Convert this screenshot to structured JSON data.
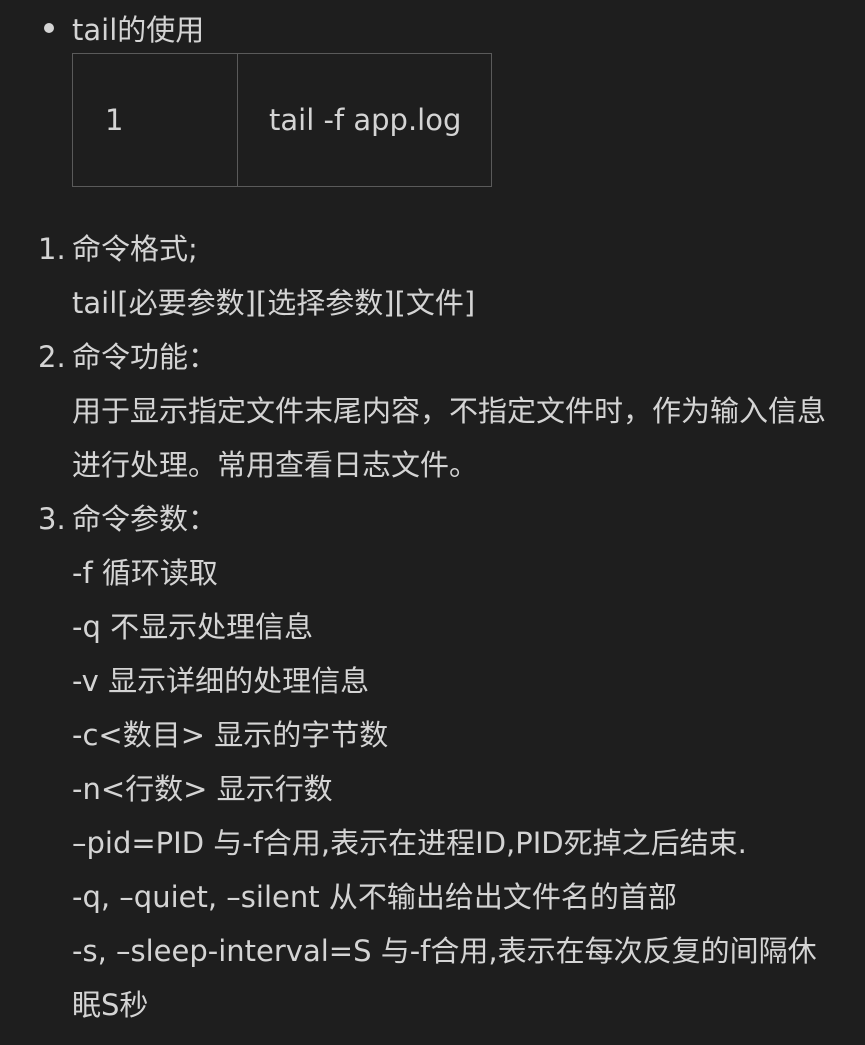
{
  "bullet": {
    "title": "tail的使用"
  },
  "code_block": {
    "line_number": "1",
    "code": "tail -f app.log"
  },
  "steps": [
    {
      "number": "1.",
      "heading": "命令格式;",
      "body": "tail[必要参数][选择参数][文件]"
    },
    {
      "number": "2.",
      "heading": "命令功能：",
      "body": "用于显示指定文件末尾内容，不指定文件时，作为输入信息进行处理。常用查看日志文件。"
    },
    {
      "number": "3.",
      "heading": "命令参数：",
      "params": [
        "-f 循环读取",
        "-q 不显示处理信息",
        "-v 显示详细的处理信息",
        "-c<数目> 显示的字节数",
        "-n<行数> 显示行数",
        "–pid=PID 与-f合用,表示在进程ID,PID死掉之后结束.",
        "-q, –quiet, –silent 从不输出给出文件名的首部",
        "-s, –sleep-interval=S 与-f合用,表示在每次反复的间隔休眠S秒"
      ]
    }
  ]
}
